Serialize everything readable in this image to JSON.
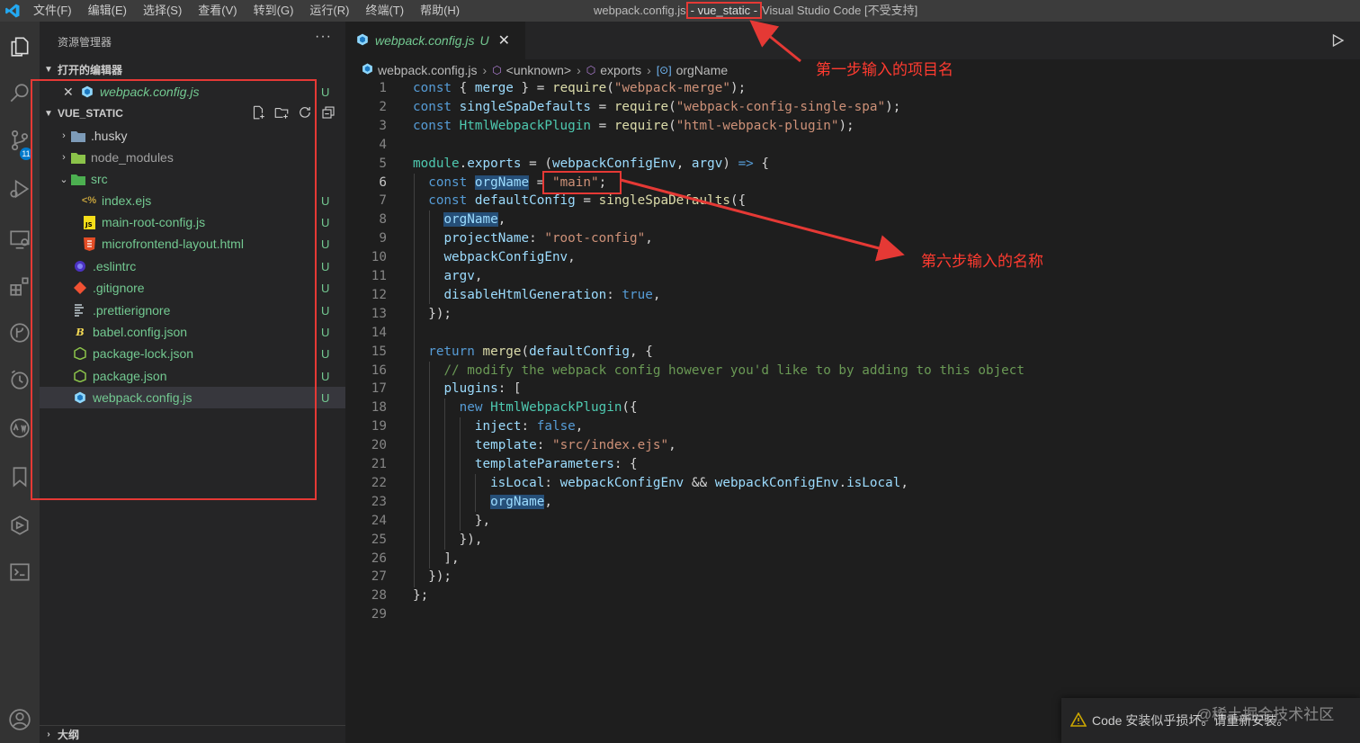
{
  "titlebar": {
    "menus": [
      "文件(F)",
      "编辑(E)",
      "选择(S)",
      "查看(V)",
      "转到(G)",
      "运行(R)",
      "终端(T)",
      "帮助(H)"
    ],
    "title_file": "webpack.config.js",
    "title_project": "- vue_static -",
    "title_app": "Visual Studio Code [不受支持]"
  },
  "activity": {
    "icons": [
      "files-icon",
      "search-icon",
      "source-control-icon",
      "run-debug-icon",
      "remote-explorer-icon",
      "extensions-icon",
      "git-graph-icon",
      "timeline-icon",
      "api-icon",
      "bookmark-icon",
      "docker-icon",
      "terminal-icon",
      "account-icon"
    ],
    "scm_badge": "11"
  },
  "sidebar": {
    "title": "资源管理器",
    "more": "···",
    "open_editors_label": "打开的编辑器",
    "open_editor_file": "webpack.config.js",
    "open_editor_status": "U",
    "project_label": "VUE_STATIC",
    "tree": [
      {
        "name": ".husky",
        "type": "folder",
        "status": ""
      },
      {
        "name": "node_modules",
        "type": "folder",
        "status": ""
      },
      {
        "name": "src",
        "type": "folder-open",
        "status": ""
      },
      {
        "name": "index.ejs",
        "type": "file",
        "status": "U"
      },
      {
        "name": "main-root-config.js",
        "type": "file",
        "status": "U"
      },
      {
        "name": "microfrontend-layout.html",
        "type": "file",
        "status": "U"
      },
      {
        "name": ".eslintrc",
        "type": "file",
        "status": "U"
      },
      {
        "name": ".gitignore",
        "type": "file",
        "status": "U"
      },
      {
        "name": ".prettierignore",
        "type": "file",
        "status": "U"
      },
      {
        "name": "babel.config.json",
        "type": "file",
        "status": "U"
      },
      {
        "name": "package-lock.json",
        "type": "file",
        "status": "U"
      },
      {
        "name": "package.json",
        "type": "file",
        "status": "U"
      },
      {
        "name": "webpack.config.js",
        "type": "file",
        "status": "U"
      }
    ],
    "outline_label": "大纲"
  },
  "editor": {
    "tab_name": "webpack.config.js",
    "tab_status": "U",
    "tab_close": "✕",
    "breadcrumb": [
      "webpack.config.js",
      "<unknown>",
      "exports",
      "orgName"
    ],
    "lines": [
      "1",
      "2",
      "3",
      "4",
      "5",
      "6",
      "7",
      "8",
      "9",
      "10",
      "11",
      "12",
      "13",
      "14",
      "15",
      "16",
      "17",
      "18",
      "19",
      "20",
      "21",
      "22",
      "23",
      "24",
      "25",
      "26",
      "27",
      "28",
      "29"
    ],
    "active_line": "6"
  },
  "annotations": {
    "step1": "第一步输入的项目名",
    "step6": "第六步输入的名称"
  },
  "toast": {
    "message": "Code 安装似乎损坏。请重新安装。"
  },
  "watermark": "@稀土掘金技术社区",
  "colors": {
    "annotation_red": "#e53935",
    "git_untracked": "#73c991",
    "keyword": "#569cd6",
    "string": "#ce9178",
    "function": "#dcdcaa",
    "variable": "#9cdcfe",
    "comment": "#6a9955"
  }
}
